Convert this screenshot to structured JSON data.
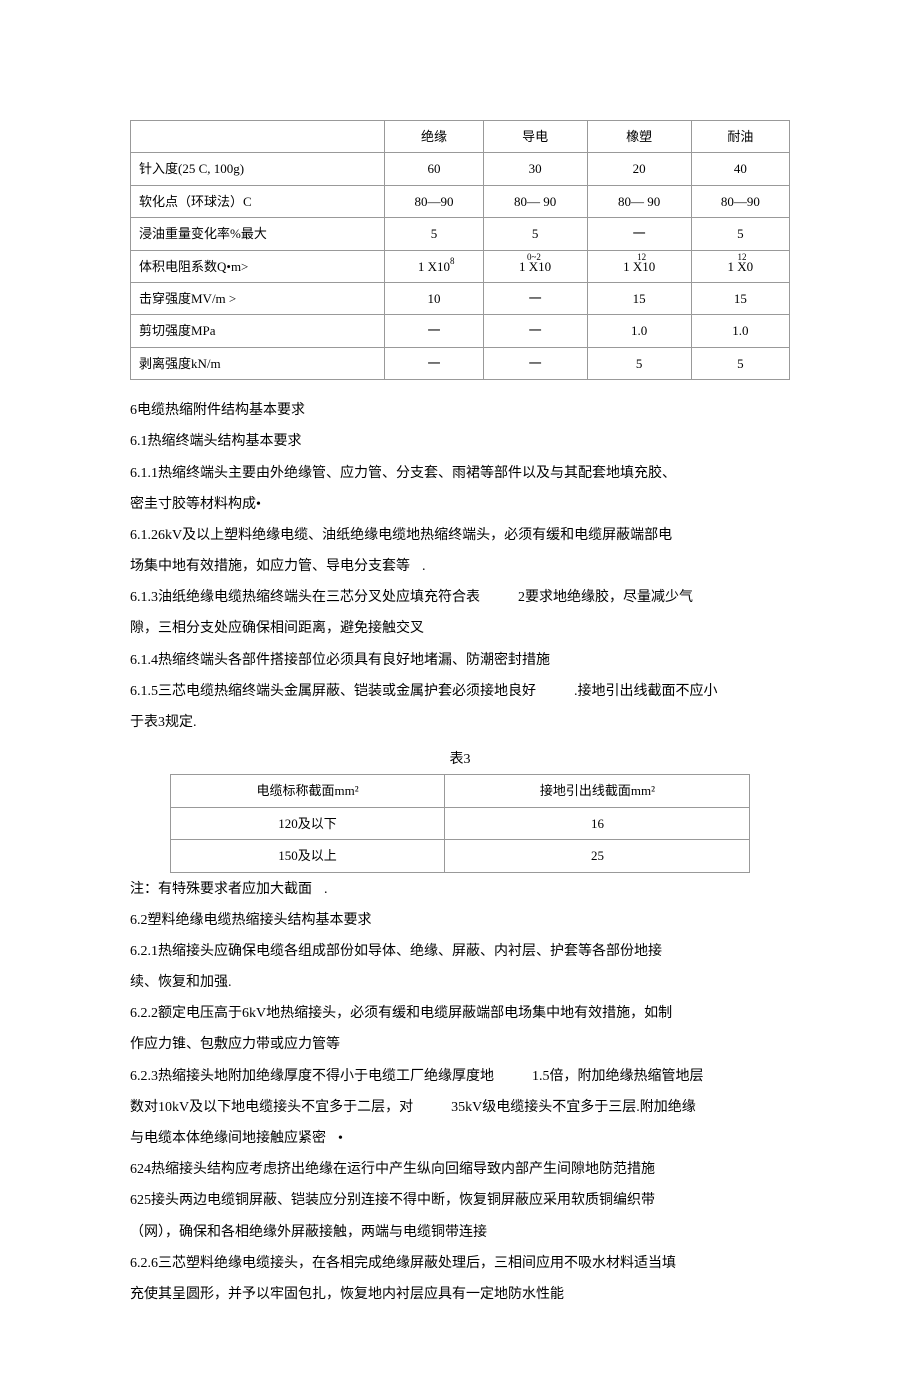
{
  "table1": {
    "headers": [
      "",
      "绝缘",
      "导电",
      "橡塑",
      "耐油"
    ],
    "rows": [
      {
        "label": "针入度(25 C, 100g)",
        "v": [
          "60",
          "30",
          "20",
          "40"
        ]
      },
      {
        "label": "软化点（环球法）C",
        "v": [
          "80—90",
          "80— 90",
          "80— 90",
          "80—90"
        ]
      },
      {
        "label": "浸油重量变化率%最大",
        "v": [
          "5",
          "5",
          "一",
          "5"
        ]
      },
      {
        "label": "体积电阻系数Q•m>",
        "v": [
          "1 X10",
          "1 X10",
          "1 X10",
          "1 X0"
        ],
        "sup": [
          "8",
          "0~2",
          "12",
          "12"
        ]
      },
      {
        "label": "击穿强度MV/m >",
        "v": [
          "10",
          "一",
          "15",
          "15"
        ]
      },
      {
        "label": "剪切强度MPa",
        "v": [
          "一",
          "一",
          "1.0",
          "1.0"
        ]
      },
      {
        "label": "剥离强度kN/m",
        "v": [
          "一",
          "一",
          "5",
          "5"
        ]
      }
    ]
  },
  "s6": {
    "h": "6电缆热缩附件结构基本要求",
    "h61": "6.1热缩终端头结构基本要求",
    "p611": "6.1.1热缩终端头主要由外绝缘管、应力管、分支套、雨裙等部件以及与其配套地填充胶、",
    "p611b": "密圭寸胶等材料构成•",
    "p612": "6.1.26kV及以上塑料绝缘电缆、油纸绝缘电缆地热缩终端头，必须有缓和电缆屏蔽端部电",
    "p612b": "场集中地有效措施，如应力管、导电分支套等",
    "p613a": "6.1.3油纸绝缘电缆热缩终端头在三芯分叉处应填充符合表",
    "p613b": "2要求地绝缘胶，尽量减少气",
    "p613c": "隙，三相分支处应确保相间距离，避免接触交叉",
    "p614": "6.1.4热缩终端头各部件搭接部位必须具有良好地堵漏、防潮密封措施",
    "p615a": "6.1.5三芯电缆热缩终端头金属屏蔽、铠装或金属护套必须接地良好",
    "p615b": ".接地引出线截面不应小",
    "p615c": "于表3规定."
  },
  "table3": {
    "caption": "表3",
    "headers": [
      "电缆标称截面mm²",
      "接地引出线截面mm²"
    ],
    "rows": [
      [
        "120及以下",
        "16"
      ],
      [
        "150及以上",
        "25"
      ]
    ],
    "note": "注：有特殊要求者应加大截面"
  },
  "s62": {
    "h62": "6.2塑料绝缘电缆热缩接头结构基本要求",
    "p621a": "6.2.1热缩接头应确保电缆各组成部份如导体、绝缘、屏蔽、内衬层、护套等各部份地接",
    "p621b": "续、恢复和加强.",
    "p622a": "6.2.2额定电压高于6kV地热缩接头，必须有缓和电缆屏蔽端部电场集中地有效措施，如制",
    "p622b": "作应力锥、包敷应力带或应力管等",
    "p623a": "6.2.3热缩接头地附加绝缘厚度不得小于电缆工厂绝缘厚度地",
    "p623b": "1.5倍，附加绝缘热缩管地层",
    "p623c": "数对10kV及以下地电缆接头不宜多于二层，对",
    "p623d": "35kV级电缆接头不宜多于三层.附加绝缘",
    "p623e": "与电缆本体绝缘间地接触应紧密",
    "p624": "624热缩接头结构应考虑挤出绝缘在运行中产生纵向回缩导致内部产生间隙地防范措施",
    "p625a": "625接头两边电缆铜屏蔽、铠装应分别连接不得中断，恢复铜屏蔽应采用软质铜编织带",
    "p625b": "（网），确保和各相绝缘外屏蔽接触，两端与电缆铜带连接",
    "p626a": "6.2.6三芯塑料绝缘电缆接头，在各相完成绝缘屏蔽处理后，三相间应用不吸水材料适当填",
    "p626b": "充使其呈圆形，并予以牢固包扎，恢复地内衬层应具有一定地防水性能"
  }
}
